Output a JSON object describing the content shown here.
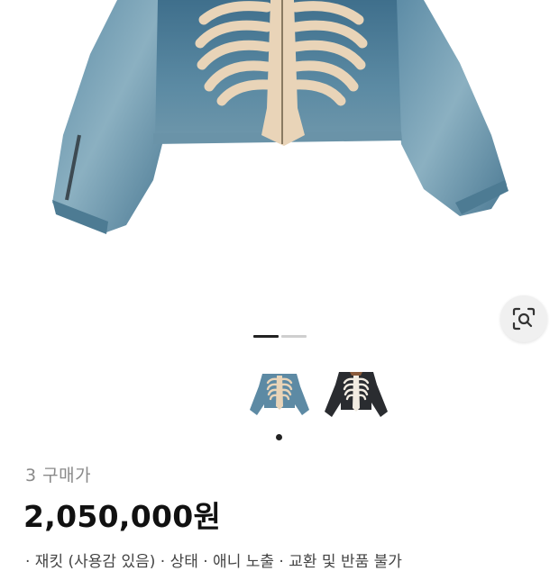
{
  "product": {
    "buyer_label": "3 구매가",
    "price": "2,050,000원",
    "description_partial": "· 재킷 (사용감 있음) · 상태 · 애니 노출 · 교환 및 반품 불가"
  },
  "gallery": {
    "active_index": 1,
    "count": 2,
    "thumbnails": [
      {
        "name": "denim-skeleton-jacket-blue"
      },
      {
        "name": "denim-skeleton-jacket-black"
      }
    ]
  },
  "actions": {
    "lens_icon": "image-search-icon"
  },
  "colors": {
    "denim": "#4f7d95",
    "bone": "#e9d4b8",
    "black_jacket": "#2a2c30",
    "indicator_active": "#222222",
    "indicator_inactive": "#cfcfcf"
  }
}
